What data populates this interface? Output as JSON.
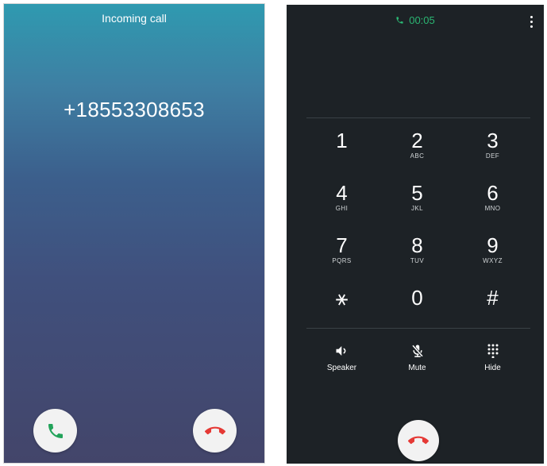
{
  "incoming_screen": {
    "title": "Incoming call",
    "caller_number": "+18553308653",
    "answer_icon": "phone-answer-icon",
    "decline_icon": "phone-decline-icon",
    "colors": {
      "answer": "#22a35a",
      "decline": "#e53935",
      "gradient_top": "#2f9ab0",
      "gradient_bottom": "#43456a"
    }
  },
  "incall_screen": {
    "timer": "00:05",
    "timer_color": "#2bb673",
    "keypad": [
      {
        "digit": "1",
        "letters": ""
      },
      {
        "digit": "2",
        "letters": "ABC"
      },
      {
        "digit": "3",
        "letters": "DEF"
      },
      {
        "digit": "4",
        "letters": "GHI"
      },
      {
        "digit": "5",
        "letters": "JKL"
      },
      {
        "digit": "6",
        "letters": "MNO"
      },
      {
        "digit": "7",
        "letters": "PQRS"
      },
      {
        "digit": "8",
        "letters": "TUV"
      },
      {
        "digit": "9",
        "letters": "WXYZ"
      },
      {
        "digit": "⚹",
        "letters": ""
      },
      {
        "digit": "0",
        "letters": ""
      },
      {
        "digit": "#",
        "letters": ""
      }
    ],
    "actions": {
      "speaker": "Speaker",
      "mute": "Mute",
      "hide": "Hide"
    },
    "end_call_color": "#e53935"
  }
}
